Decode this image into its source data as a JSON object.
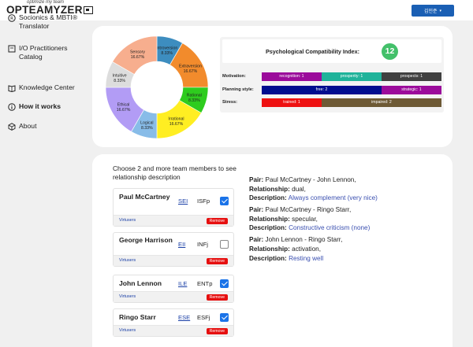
{
  "header": {
    "logo_tagline": "optimize my team",
    "logo_text": "OPTEAMYZER",
    "user_label": "김민준",
    "user_caret": "▾"
  },
  "sidebar": {
    "items": [
      {
        "label": "Socionics & MBTI® Translator",
        "icon": "translate-icon"
      },
      {
        "label": "I/O Practitioners Catalog",
        "icon": "catalog-icon"
      },
      {
        "label": "Knowledge Center",
        "icon": "book-icon"
      },
      {
        "label": "How it works",
        "icon": "info-icon"
      },
      {
        "label": "About",
        "icon": "cube-icon"
      }
    ]
  },
  "chart_data": {
    "type": "pie",
    "donut": true,
    "slices": [
      {
        "label": "Introversion",
        "value": 8.33,
        "color": "#3d8dbf"
      },
      {
        "label": "Extraversion",
        "value": 16.67,
        "color": "#f28b2c"
      },
      {
        "label": "Rational",
        "value": 8.33,
        "color": "#2ecc1e"
      },
      {
        "label": "Irrational",
        "value": 16.67,
        "color": "#ffee22"
      },
      {
        "label": "Logical",
        "value": 8.33,
        "color": "#88bce8"
      },
      {
        "label": "Ethical",
        "value": 16.67,
        "color": "#b29cf5"
      },
      {
        "label": "Intuitive",
        "value": 8.33,
        "color": "#dddddd"
      },
      {
        "label": "Sensory",
        "value": 16.67,
        "color": "#f7ae8e"
      }
    ]
  },
  "compatibility": {
    "title": "Psychological Compatibility Index:",
    "score": "12",
    "rows": [
      {
        "label": "Motivation:",
        "segments": [
          {
            "text": "recognition: 1",
            "value": 1,
            "color": "#9b0b9b"
          },
          {
            "text": "prosperity: 1",
            "value": 1,
            "color": "#1fb39a"
          },
          {
            "text": "prospects: 1",
            "value": 1,
            "color": "#404040"
          }
        ]
      },
      {
        "label": "Planning style:",
        "segments": [
          {
            "text": "free: 2",
            "value": 2,
            "color": "#000d8f"
          },
          {
            "text": "strategic: 1",
            "value": 1,
            "color": "#9b0b9b"
          }
        ]
      },
      {
        "label": "Stress:",
        "segments": [
          {
            "text": "trained: 1",
            "value": 1,
            "color": "#ee1111"
          },
          {
            "text": "impaired: 2",
            "value": 2,
            "color": "#6e5a35"
          }
        ]
      }
    ]
  },
  "team": {
    "instruction": "Choose 2 and more team members to see relationship description",
    "members": [
      {
        "name": "Paul McCartney",
        "code": "SEI",
        "type": "ISFp",
        "checked": true,
        "source": "Virtusers",
        "remove_label": "Remove"
      },
      {
        "name": "George Harrison",
        "code": "EII",
        "type": "INFj",
        "checked": false,
        "source": "Virtusers",
        "remove_label": "Remove"
      },
      {
        "name": "John Lennon",
        "code": "ILE",
        "type": "ENTp",
        "checked": true,
        "source": "Virtusers",
        "remove_label": "Remove"
      },
      {
        "name": "Ringo Starr",
        "code": "ESE",
        "type": "ESFj",
        "checked": true,
        "source": "Virtusers",
        "remove_label": "Remove"
      }
    ]
  },
  "relationships": {
    "pair_label": "Pair:",
    "relationship_label": "Relationship:",
    "description_label": "Description:",
    "items": [
      {
        "pair": "Paul McCartney - John Lennon,",
        "relationship": "dual,",
        "description": "Always complement (very nice)"
      },
      {
        "pair": "Paul McCartney - Ringo Starr,",
        "relationship": "specular,",
        "description": "Constructive criticism (none)"
      },
      {
        "pair": "John Lennon - Ringo Starr,",
        "relationship": "activation,",
        "description": "Resting well"
      }
    ]
  }
}
